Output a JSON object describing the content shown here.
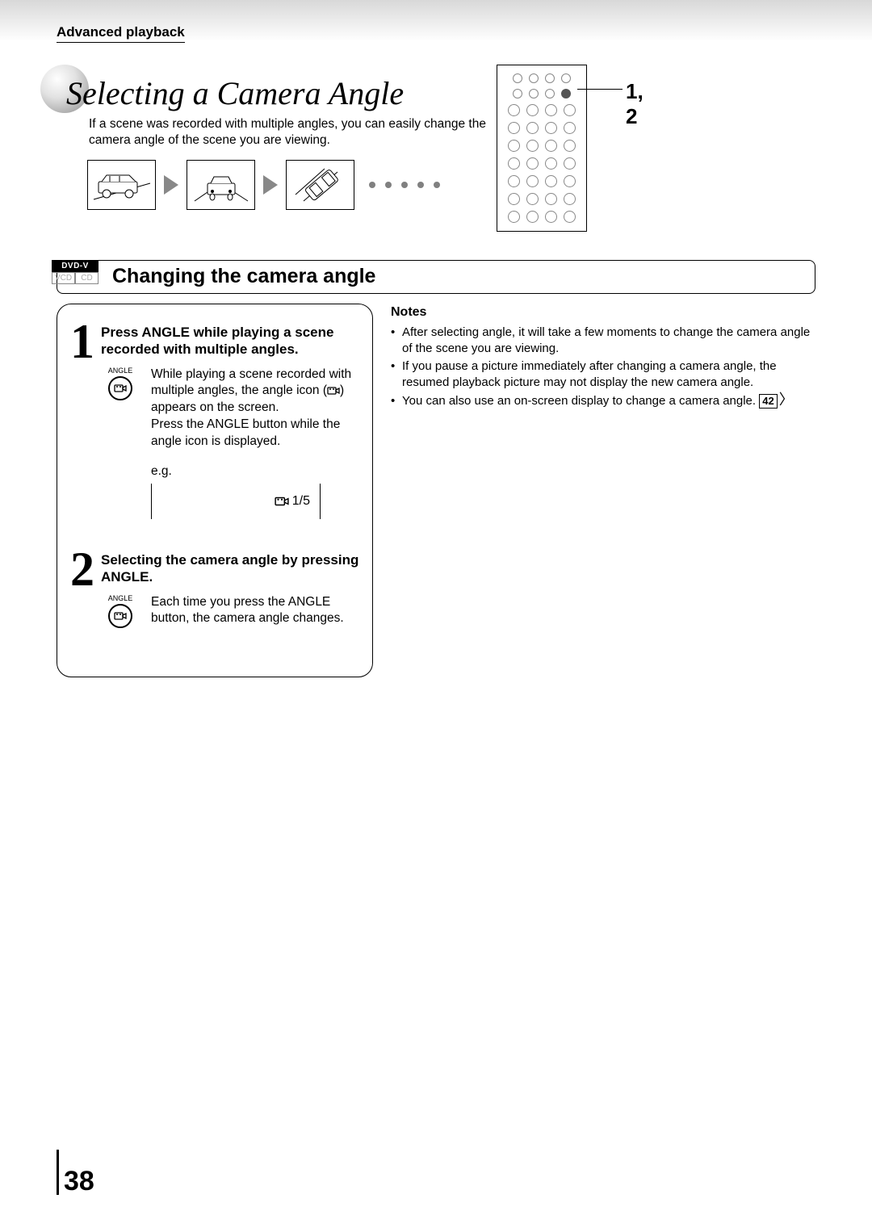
{
  "section_label": "Advanced playback",
  "page_title": "Selecting a Camera Angle",
  "intro": "If a scene was recorded with multiple angles, you can easily change the camera angle of the scene you are viewing.",
  "remote_callout": "1, 2",
  "formats": {
    "dvd": "DVD-V",
    "vcd": "VCD",
    "cd": "CD"
  },
  "section_bar": "Changing the camera angle",
  "steps": {
    "s1": {
      "num": "1",
      "title": "Press ANGLE while playing a scene recorded with multiple angles.",
      "btn_label": "ANGLE",
      "text_a": "While playing a scene recorded with multiple angles, the angle icon (",
      "text_b": ") appears on the screen.",
      "text_c": "Press the ANGLE button while the angle icon is displayed.",
      "eg_label": "e.g.",
      "osd_value": "1/5"
    },
    "s2": {
      "num": "2",
      "title": "Selecting the camera angle by pressing ANGLE.",
      "btn_label": "ANGLE",
      "text": "Each time you press the ANGLE button, the camera angle changes."
    }
  },
  "notes": {
    "title": "Notes",
    "items": [
      "After selecting angle, it will take a few moments to change the camera angle of the scene you are viewing.",
      "If you pause a picture immediately after changing a camera angle, the resumed playback picture may not display the new camera angle.",
      "You can also use an on-screen display to change a camera angle."
    ],
    "page_ref": "42"
  },
  "page_number": "38"
}
